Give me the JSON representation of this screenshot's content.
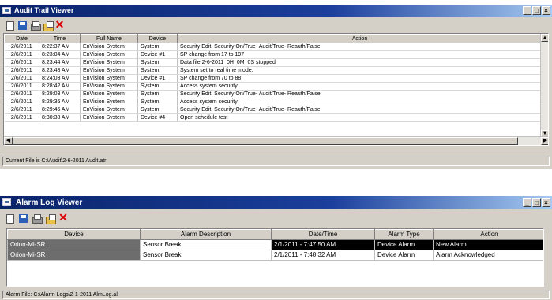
{
  "audit": {
    "title": "Audit Trail Viewer",
    "columns": [
      "Date",
      "Time",
      "Full Name",
      "Device",
      "Action"
    ],
    "rows": [
      [
        "2/6/2011",
        "8:22:37 AM",
        "EnVision System",
        "System",
        "Security Edit. Security On/True- Audit/True- Reauth/False"
      ],
      [
        "2/6/2011",
        "8:23:04 AM",
        "EnVision System",
        "Device #1",
        "SP change from 17 to 197"
      ],
      [
        "2/6/2011",
        "8:23:44 AM",
        "EnVision System",
        "System",
        "Data file 2-6-2011_0H_0M_0S stopped"
      ],
      [
        "2/6/2011",
        "8:23:48 AM",
        "EnVision System",
        "System",
        "System set to real time mode."
      ],
      [
        "2/6/2011",
        "8:24:03 AM",
        "EnVision System",
        "Device #1",
        "SP change from 70 to 88"
      ],
      [
        "2/6/2011",
        "8:28:42 AM",
        "EnVision System",
        "System",
        "Access system security"
      ],
      [
        "2/6/2011",
        "8:29:03 AM",
        "EnVision System",
        "System",
        "Security Edit. Security On/True- Audit/True- Reauth/False"
      ],
      [
        "2/6/2011",
        "8:29:36 AM",
        "EnVision System",
        "System",
        "Access system security"
      ],
      [
        "2/6/2011",
        "8:29:45 AM",
        "EnVision System",
        "System",
        "Security Edit. Security On/True- Audit/True- Reauth/False"
      ],
      [
        "2/6/2011",
        "8:30:38 AM",
        "EnVision System",
        "Device #4",
        "Open schedule test"
      ]
    ],
    "status": "Current File is C:\\Audit\\2-6-2011 Audit.atr"
  },
  "alarm": {
    "title": "Alarm Log Viewer",
    "columns": [
      "Device",
      "Alarm Description",
      "Date/Time",
      "Alarm Type",
      "Action"
    ],
    "rows": [
      [
        "Orion-Mi-SR",
        "Sensor Break",
        "2/1/2011 - 7:47:50 AM",
        "Device Alarm",
        "New Alarm"
      ],
      [
        "Orion-Mi-SR",
        "Sensor Break",
        "2/1/2011 - 7:48:32 AM",
        "Device Alarm",
        "Alarm Acknowledged"
      ]
    ],
    "status": "Alarm File: C:\\Alarm Logs\\2-1-2011 AlmLog.all"
  },
  "window_buttons": {
    "minimize": "_",
    "maximize": "□",
    "close": "×"
  },
  "icons": [
    "new-icon",
    "save-icon",
    "print-icon",
    "open-folder-icon",
    "delete-icon"
  ],
  "colors": {
    "title_start": "#0a246a",
    "title_end": "#a6caf0",
    "face": "#d4d0c8",
    "delete": "#dd0000"
  }
}
